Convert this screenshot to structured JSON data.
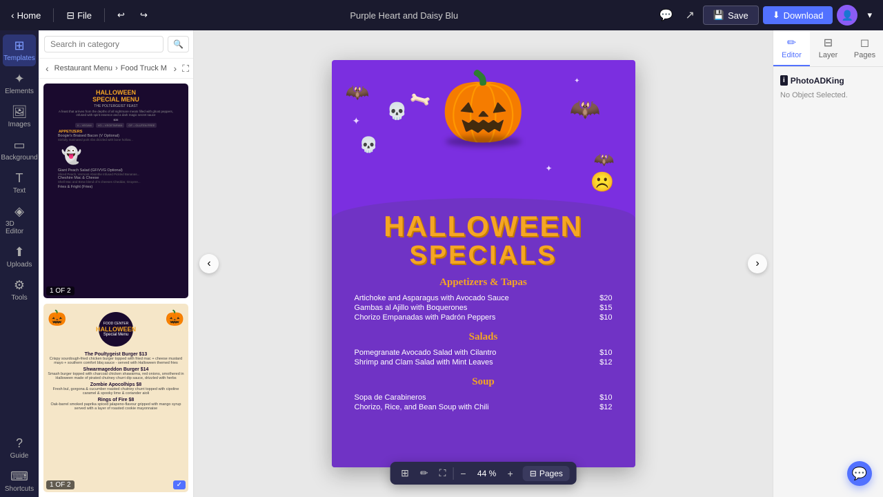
{
  "topbar": {
    "home_label": "Home",
    "file_label": "File",
    "filename": "Purple Heart and Daisy Blu",
    "save_label": "Save",
    "download_label": "Download",
    "icons": {
      "undo": "↩",
      "redo": "↪",
      "comment": "💬",
      "share": "↗",
      "chevron_down": "▾"
    }
  },
  "sidebar": {
    "items": [
      {
        "id": "templates",
        "label": "Templates",
        "icon": "⊞",
        "active": true
      },
      {
        "id": "elements",
        "label": "Elements",
        "icon": "✦"
      },
      {
        "id": "images",
        "label": "Images",
        "icon": "🖼"
      },
      {
        "id": "background",
        "label": "Background",
        "icon": "▭"
      },
      {
        "id": "text",
        "label": "Text",
        "icon": "T"
      },
      {
        "id": "3d-editor",
        "label": "3D Editor",
        "icon": "◈"
      },
      {
        "id": "uploads",
        "label": "Uploads",
        "icon": "⬆"
      },
      {
        "id": "tools",
        "label": "Tools",
        "icon": "⚙"
      },
      {
        "id": "guide",
        "label": "Guide",
        "icon": "?"
      },
      {
        "id": "shortcuts",
        "label": "Shortcuts",
        "icon": "⌨"
      }
    ]
  },
  "panel": {
    "search_placeholder": "Search in category",
    "nav_items": [
      "Restaurant Menu",
      "Food Truck M"
    ],
    "template1": {
      "label": "1 OF 2"
    },
    "template2": {
      "label": "1 OF 2",
      "badge": "✓"
    }
  },
  "canvas": {
    "doc": {
      "title_line1": "HALLOWEEN",
      "title_line2": "SPECIALS",
      "sections": [
        {
          "title": "Appetizers & Tapas",
          "items": [
            {
              "name": "Artichoke and Asparagus with Avocado Sauce",
              "price": "$20"
            },
            {
              "name": "Gambas al Ajillo with Boquerones",
              "price": "$15"
            },
            {
              "name": "Chorizo Empanadas with Padrón Peppers",
              "price": "$10"
            }
          ]
        },
        {
          "title": "Salads",
          "items": [
            {
              "name": "Pomegranate Avocado Salad with Cilantro",
              "price": "$10"
            },
            {
              "name": "Shrimp and Clam Salad with Mint Leaves",
              "price": "$12"
            }
          ]
        },
        {
          "title": "Soup",
          "items": [
            {
              "name": "Sopa de Carabineros",
              "price": "$10"
            },
            {
              "name": "Chorizo, Rice, and Bean Soup with Chili",
              "price": "$12"
            }
          ]
        }
      ]
    },
    "toolbar": {
      "grid_icon": "⊞",
      "edit_icon": "✏",
      "screen_icon": "⛶",
      "zoom_minus": "−",
      "zoom_value": "44 %",
      "zoom_plus": "+",
      "pages_label": "Pages"
    }
  },
  "right_panel": {
    "tabs": [
      {
        "id": "editor",
        "label": "Editor",
        "icon": "✏",
        "active": true
      },
      {
        "id": "layer",
        "label": "Layer",
        "icon": "⊟"
      },
      {
        "id": "pages",
        "label": "Pages",
        "icon": "◻"
      }
    ],
    "brand_name": "PhotoADKing",
    "no_object": "No Object Selected."
  }
}
